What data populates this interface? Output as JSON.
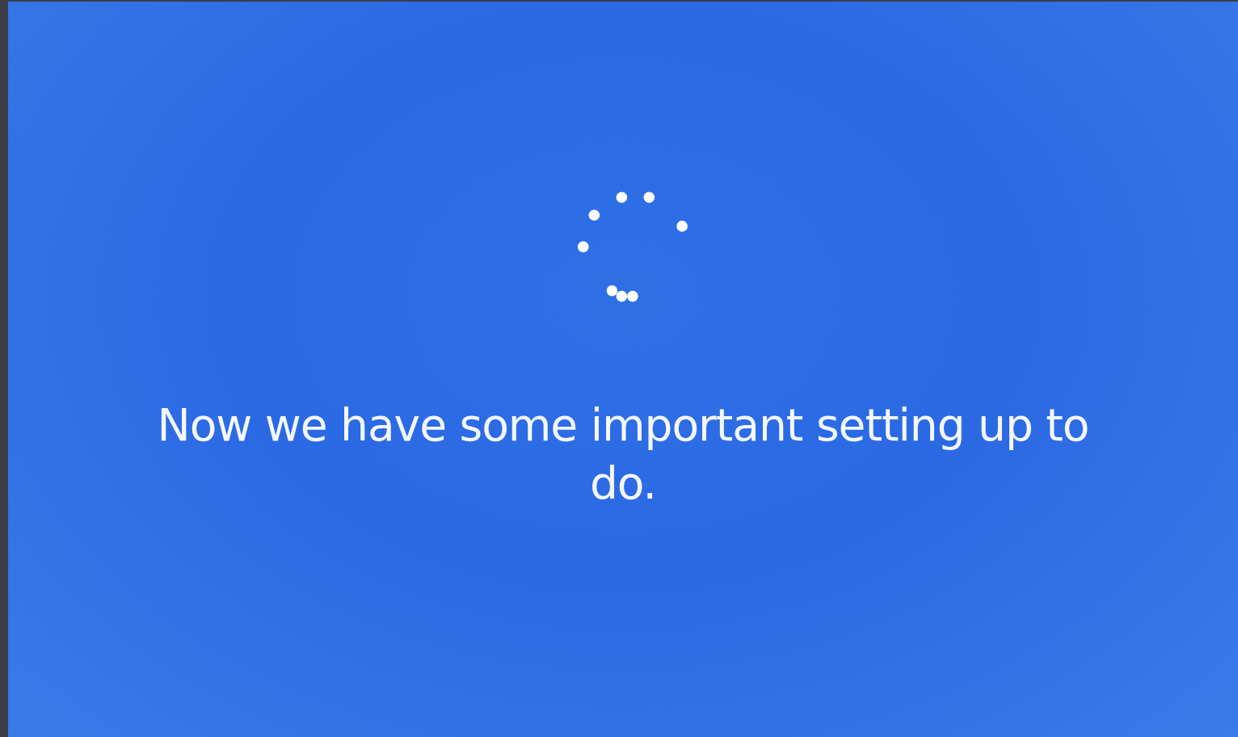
{
  "message": "Now we have some important setting up to do."
}
